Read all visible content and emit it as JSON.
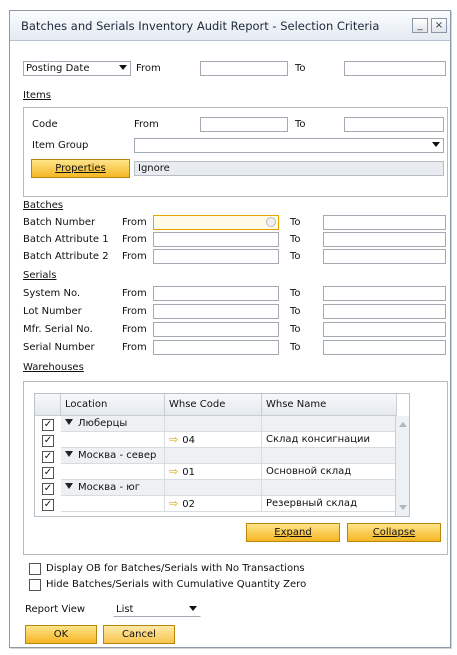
{
  "window": {
    "title": "Batches and Serials Inventory Audit Report - Selection Criteria",
    "minimize_label": "_",
    "close_label": "×"
  },
  "posting": {
    "select_value": "Posting Date",
    "from_label": "From",
    "to_label": "To",
    "from_value": "",
    "to_value": ""
  },
  "items": {
    "section_label": "Items",
    "code_label": "Code",
    "code_from_label": "From",
    "code_to_label": "To",
    "item_group_label": "Item Group",
    "item_group_value": "",
    "properties_button": "Properties",
    "properties_value": "Ignore"
  },
  "batches": {
    "section_label": "Batches",
    "rows": [
      {
        "label": "Batch Number",
        "from_label": "From",
        "to_label": "To"
      },
      {
        "label": "Batch Attribute 1",
        "from_label": "From",
        "to_label": "To"
      },
      {
        "label": "Batch Attribute 2",
        "from_label": "From",
        "to_label": "To"
      }
    ]
  },
  "serials": {
    "section_label": "Serials",
    "rows": [
      {
        "label": "System No.",
        "from_label": "From",
        "to_label": "To"
      },
      {
        "label": "Lot Number",
        "from_label": "From",
        "to_label": "To"
      },
      {
        "label": "Mfr. Serial No.",
        "from_label": "From",
        "to_label": "To"
      },
      {
        "label": "Serial Number",
        "from_label": "From",
        "to_label": "To"
      }
    ]
  },
  "warehouses": {
    "section_label": "Warehouses",
    "columns": [
      "Location",
      "Whse Code",
      "Whse Name"
    ],
    "rows": [
      {
        "checked": true,
        "location": "Люберцы",
        "code": "",
        "name": "",
        "group": true
      },
      {
        "checked": true,
        "location": "",
        "code": "04",
        "name": "Склад консигнации",
        "group": false
      },
      {
        "checked": true,
        "location": "Москва - север",
        "code": "",
        "name": "",
        "group": true
      },
      {
        "checked": true,
        "location": "",
        "code": "01",
        "name": "Основной склад",
        "group": false
      },
      {
        "checked": true,
        "location": "Москва - юг",
        "code": "",
        "name": "",
        "group": true
      },
      {
        "checked": true,
        "location": "",
        "code": "02",
        "name": "Резервный склад",
        "group": false
      }
    ],
    "expand_button": "Expand",
    "collapse_button": "Collapse"
  },
  "options": {
    "display_ob": {
      "label": "Display OB for Batches/Serials with No Transactions",
      "checked": false
    },
    "hide_zero": {
      "label": "Hide Batches/Serials with Cumulative Quantity Zero",
      "checked": false
    }
  },
  "report_view": {
    "label": "Report View",
    "value": "List"
  },
  "footer": {
    "ok_button": "OK",
    "cancel_button": "Cancel"
  },
  "colors": {
    "accent": "#f5b624",
    "frame": "#b3bac2"
  }
}
